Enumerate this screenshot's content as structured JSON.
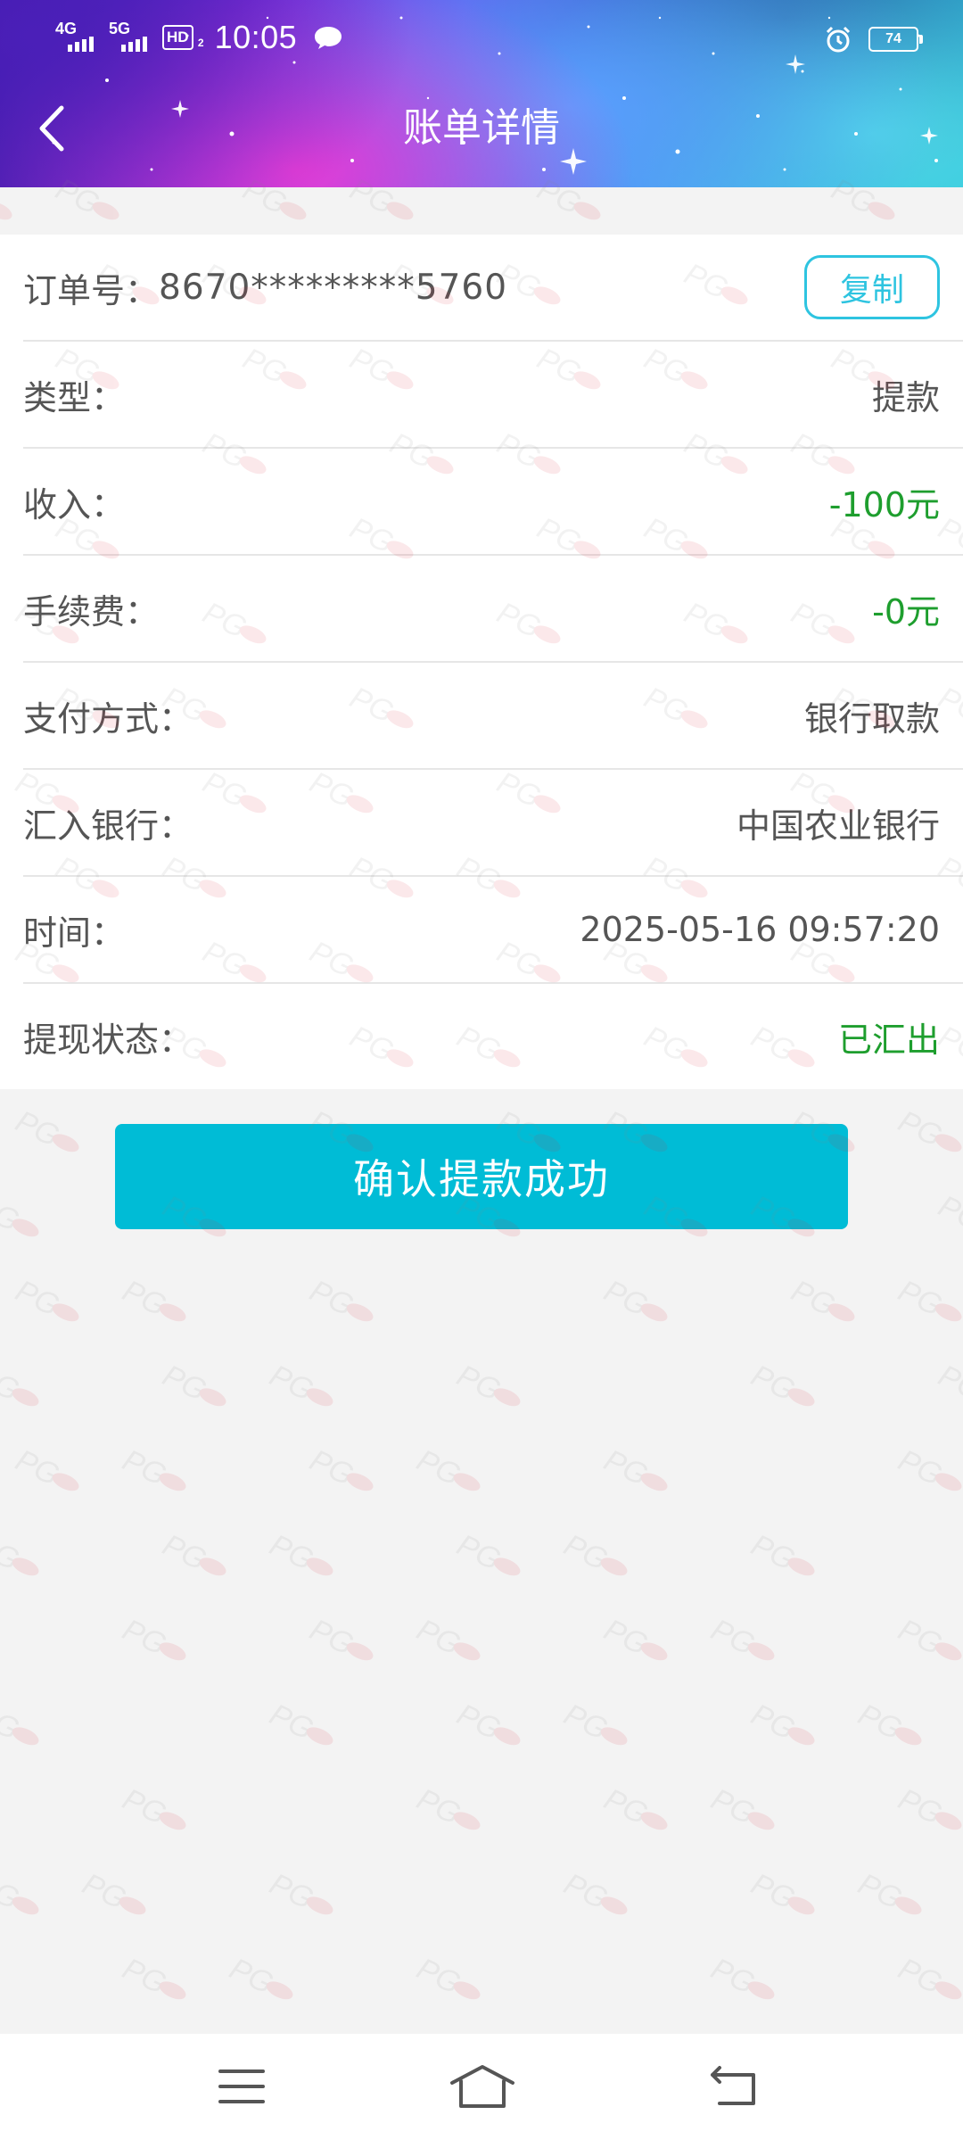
{
  "status_bar": {
    "network1": "4G",
    "network2": "5G",
    "hd": "HD",
    "hd_sub": "2",
    "time": "10:05",
    "battery": "74",
    "icons": [
      "signal-icon",
      "signal-icon",
      "hd-icon",
      "message-icon",
      "alarm-icon",
      "battery-icon"
    ]
  },
  "nav": {
    "title": "账单详情",
    "back_icon": "chevron-left-icon"
  },
  "order": {
    "label": "订单号：",
    "value": "8670*********5760",
    "copy_label": "复制"
  },
  "rows": [
    {
      "label": "类型：",
      "value": "提款",
      "color": "#555555"
    },
    {
      "label": "收入：",
      "value": "-100元",
      "color": "#1e9e2e"
    },
    {
      "label": "手续费：",
      "value": "-0元",
      "color": "#1e9e2e"
    },
    {
      "label": "支付方式：",
      "value": "银行取款",
      "color": "#555555"
    },
    {
      "label": "汇入银行：",
      "value": "中国农业银行",
      "color": "#555555"
    },
    {
      "label": "时间：",
      "value": "2025-05-16 09:57:20",
      "color": "#555555"
    },
    {
      "label": "提现状态：",
      "value": "已汇出",
      "color": "#1e9e2e"
    }
  ],
  "confirm_button": "确认提款成功",
  "watermark_text": "PG",
  "bottom_nav": [
    "menu-icon",
    "home-icon",
    "back-icon"
  ],
  "colors": {
    "accent": "#00bcd6",
    "copy_border": "#2ec4e0",
    "green": "#1e9e2e",
    "background": "#f3f3f3"
  }
}
